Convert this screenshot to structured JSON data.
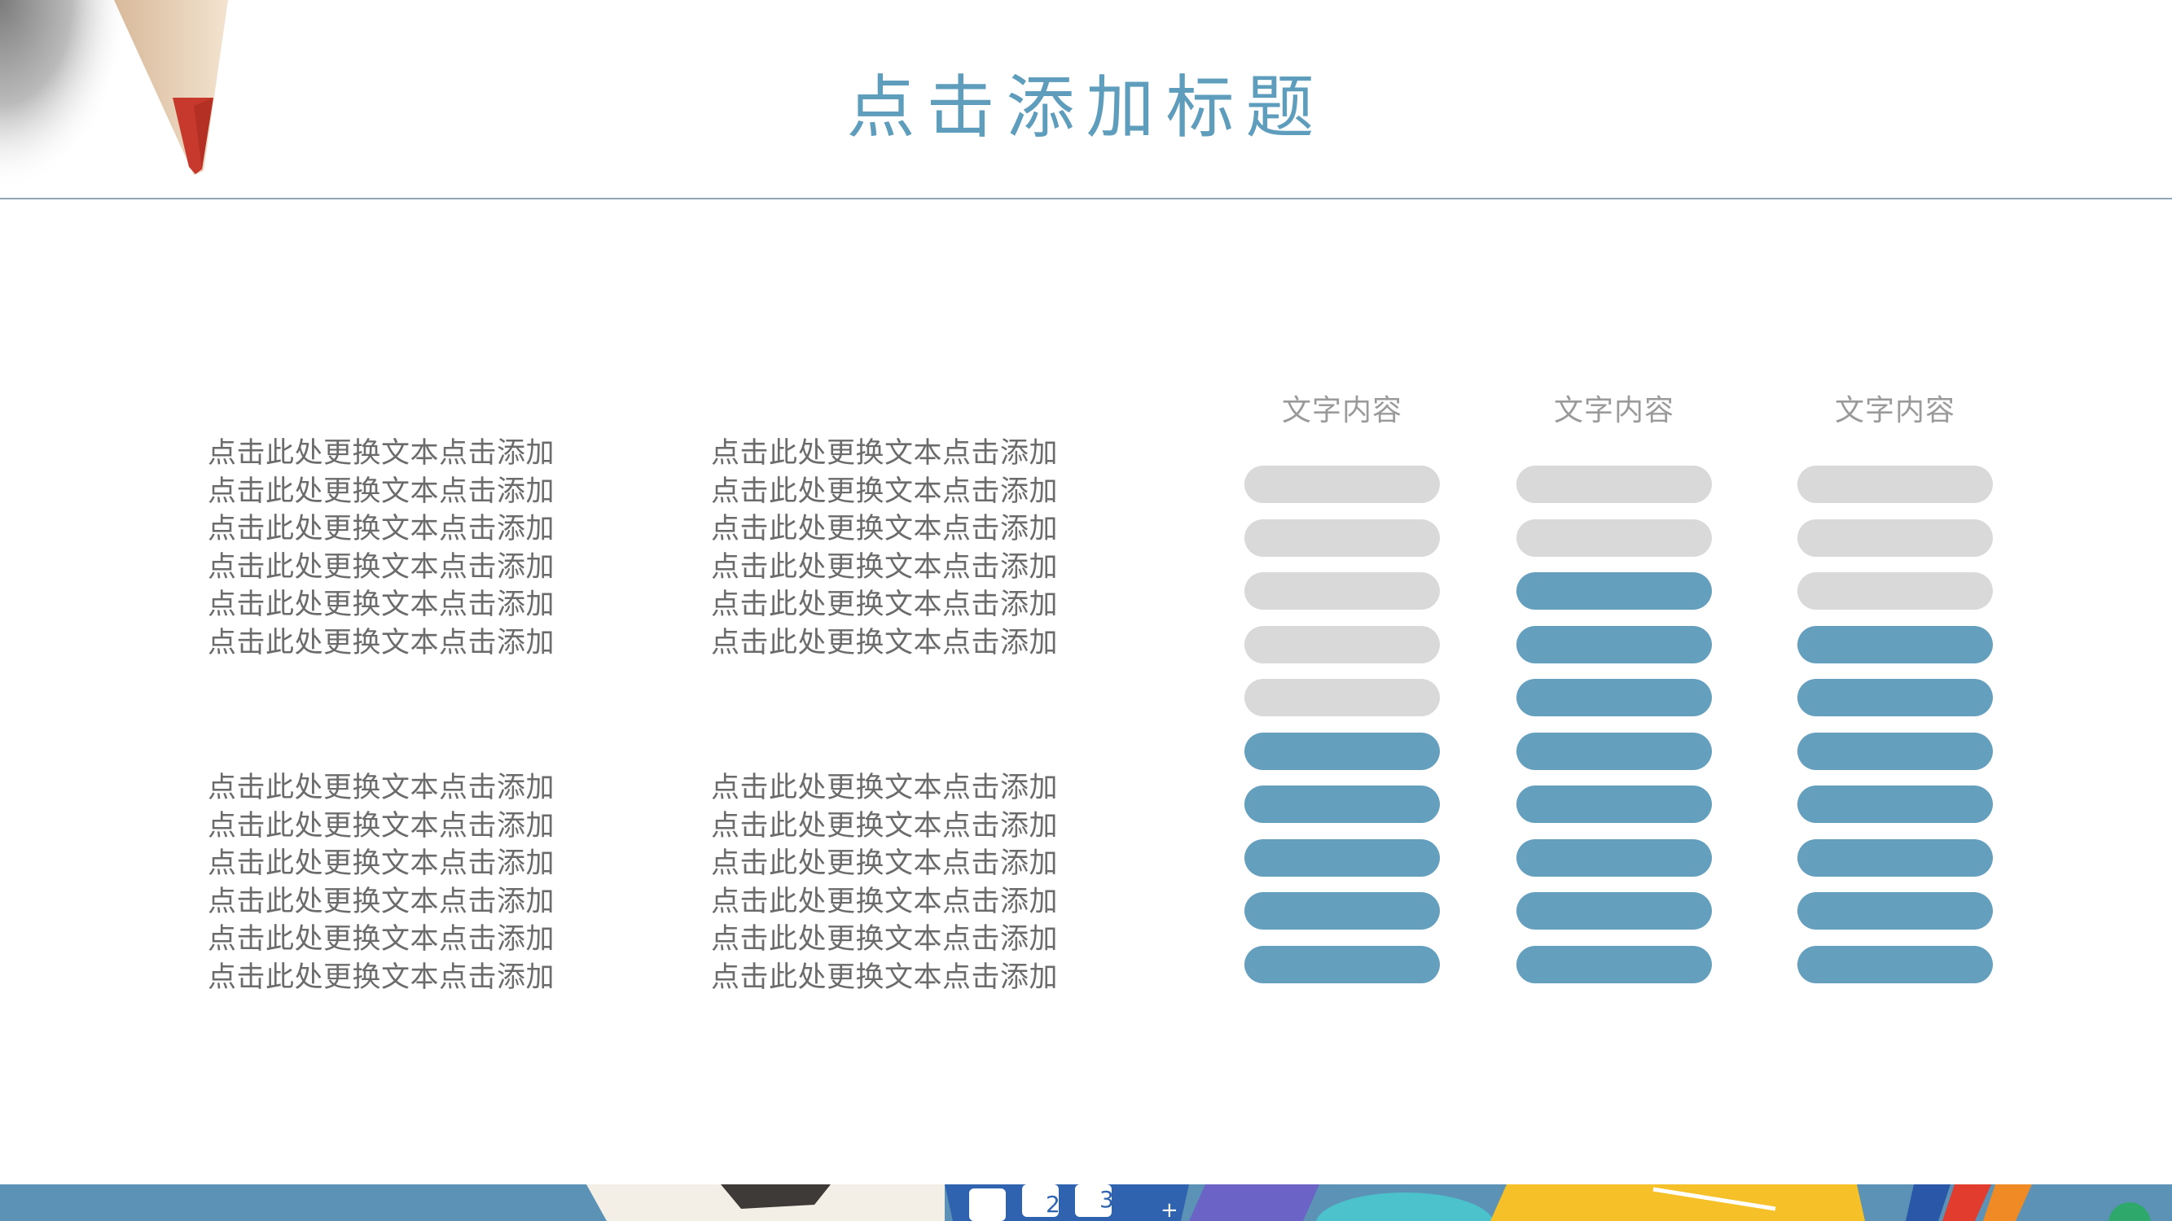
{
  "title": "点击添加标题",
  "text_blocks": [
    [
      "点击此处更换文本点击添加",
      "点击此处更换文本点击添加",
      "点击此处更换文本点击添加",
      "点击此处更换文本点击添加",
      "点击此处更换文本点击添加",
      "点击此处更换文本点击添加"
    ],
    [
      "点击此处更换文本点击添加",
      "点击此处更换文本点击添加",
      "点击此处更换文本点击添加",
      "点击此处更换文本点击添加",
      "点击此处更换文本点击添加",
      "点击此处更换文本点击添加"
    ],
    [
      "点击此处更换文本点击添加",
      "点击此处更换文本点击添加",
      "点击此处更换文本点击添加",
      "点击此处更换文本点击添加",
      "点击此处更换文本点击添加",
      "点击此处更换文本点击添加"
    ],
    [
      "点击此处更换文本点击添加",
      "点击此处更换文本点击添加",
      "点击此处更换文本点击添加",
      "点击此处更换文本点击添加",
      "点击此处更换文本点击添加",
      "点击此处更换文本点击添加"
    ]
  ],
  "bar_columns": [
    {
      "label": "文字内容",
      "total": 10,
      "filled": 5
    },
    {
      "label": "文字内容",
      "total": 10,
      "filled": 8
    },
    {
      "label": "文字内容",
      "total": 10,
      "filled": 7
    }
  ],
  "colors": {
    "accent": "#659fbe",
    "empty": "#d9d9d9",
    "title": "#5f9dbd",
    "text": "#6b6b6b"
  },
  "icons": [
    "pencil-tip-icon",
    "school-supplies-strip"
  ]
}
